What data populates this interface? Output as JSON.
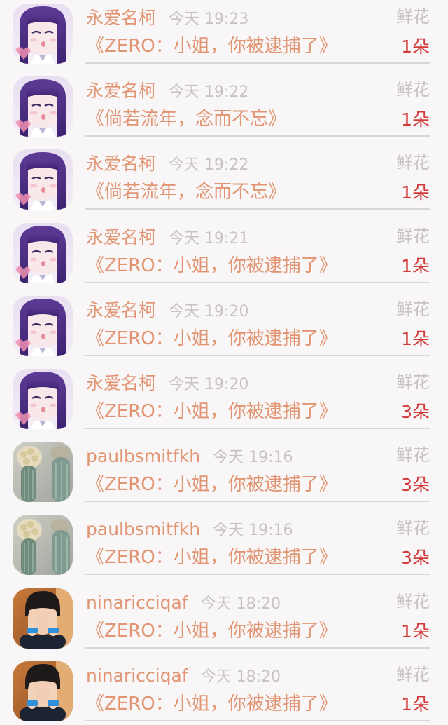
{
  "items": [
    {
      "name": "永爱名柯",
      "time": "今天 19:23",
      "gift": "鲜花",
      "message": "《ZERO：小姐，你被逮捕了》",
      "count": "1朵",
      "avatar": "anime-girl"
    },
    {
      "name": "永爱名柯",
      "time": "今天 19:22",
      "gift": "鲜花",
      "message": "《倘若流年，念而不忘》",
      "count": "1朵",
      "avatar": "anime-girl"
    },
    {
      "name": "永爱名柯",
      "time": "今天 19:22",
      "gift": "鲜花",
      "message": "《倘若流年，念而不忘》",
      "count": "1朵",
      "avatar": "anime-girl"
    },
    {
      "name": "永爱名柯",
      "time": "今天 19:21",
      "gift": "鲜花",
      "message": "《ZERO：小姐，你被逮捕了》",
      "count": "1朵",
      "avatar": "anime-girl"
    },
    {
      "name": "永爱名柯",
      "time": "今天 19:20",
      "gift": "鲜花",
      "message": "《ZERO：小姐，你被逮捕了》",
      "count": "1朵",
      "avatar": "anime-girl"
    },
    {
      "name": "永爱名柯",
      "time": "今天 19:20",
      "gift": "鲜花",
      "message": "《ZERO：小姐，你被逮捕了》",
      "count": "3朵",
      "avatar": "anime-girl"
    },
    {
      "name": "paulbsmitfkh",
      "time": "今天 19:16",
      "gift": "鲜花",
      "message": "《ZERO：小姐，你被逮捕了》",
      "count": "3朵",
      "avatar": "cactus-photo"
    },
    {
      "name": "paulbsmitfkh",
      "time": "今天 19:16",
      "gift": "鲜花",
      "message": "《ZERO：小姐，你被逮捕了》",
      "count": "3朵",
      "avatar": "cactus-photo"
    },
    {
      "name": "ninaricciqaf",
      "time": "今天 18:20",
      "gift": "鲜花",
      "message": "《ZERO：小姐，你被逮捕了》",
      "count": "1朵",
      "avatar": "person-photo"
    },
    {
      "name": "ninaricciqaf",
      "time": "今天 18:20",
      "gift": "鲜花",
      "message": "《ZERO：小姐，你被逮捕了》",
      "count": "1朵",
      "avatar": "person-photo"
    }
  ],
  "colors": {
    "name": "#e29572",
    "message": "#e29572",
    "muted": "#c7c3c3",
    "count": "#d23b3b",
    "background": "#f8f6f7"
  }
}
